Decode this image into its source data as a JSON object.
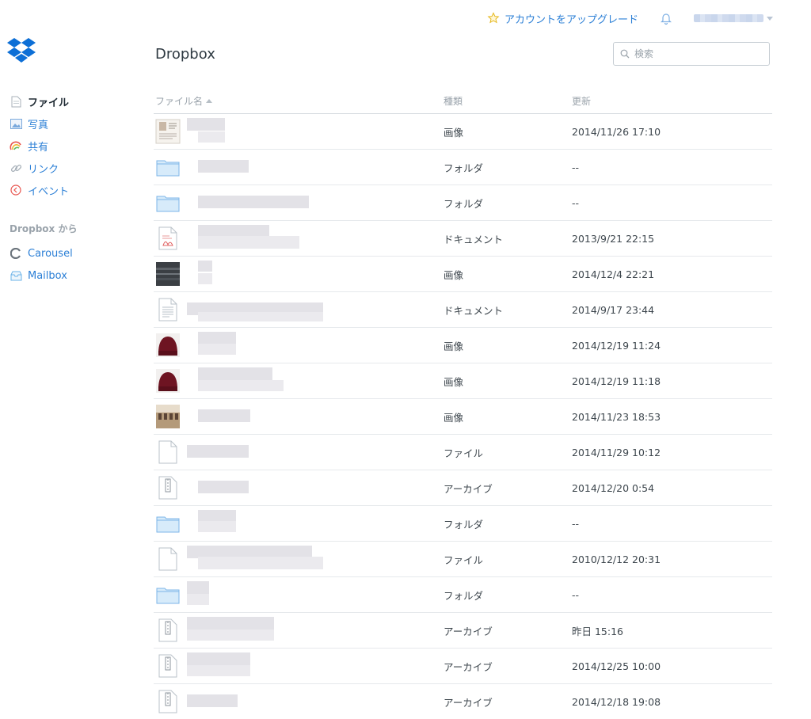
{
  "topbar": {
    "upgrade_label": "アカウントをアップグレード"
  },
  "sidebar": {
    "items": [
      {
        "label": "ファイル",
        "icon": "file-icon",
        "active": true
      },
      {
        "label": "写真",
        "icon": "photo-icon",
        "active": false
      },
      {
        "label": "共有",
        "icon": "rainbow-icon",
        "active": false
      },
      {
        "label": "リンク",
        "icon": "link-icon",
        "active": false
      },
      {
        "label": "イベント",
        "icon": "event-icon",
        "active": false
      }
    ],
    "section_title": "Dropbox から",
    "apps": [
      {
        "label": "Carousel",
        "icon": "carousel-icon"
      },
      {
        "label": "Mailbox",
        "icon": "mailbox-icon"
      }
    ]
  },
  "header": {
    "title": "Dropbox",
    "search_placeholder": "検索"
  },
  "table": {
    "columns": {
      "name": "ファイル名",
      "kind": "種類",
      "modified": "更新"
    },
    "rows": [
      {
        "kind": "画像",
        "modified": "2014/11/26 17:10",
        "thumb": "doc-image"
      },
      {
        "kind": "フォルダ",
        "modified": "--",
        "thumb": "folder"
      },
      {
        "kind": "フォルダ",
        "modified": "--",
        "thumb": "folder"
      },
      {
        "kind": "ドキュメント",
        "modified": "2013/9/21 22:15",
        "thumb": "pdf"
      },
      {
        "kind": "画像",
        "modified": "2014/12/4 22:21",
        "thumb": "dark-image"
      },
      {
        "kind": "ドキュメント",
        "modified": "2014/9/17 23:44",
        "thumb": "document"
      },
      {
        "kind": "画像",
        "modified": "2014/12/19 11:24",
        "thumb": "hat-image"
      },
      {
        "kind": "画像",
        "modified": "2014/12/19 11:18",
        "thumb": "hat-image"
      },
      {
        "kind": "画像",
        "modified": "2014/11/23 18:53",
        "thumb": "room-image"
      },
      {
        "kind": "ファイル",
        "modified": "2014/11/29 10:12",
        "thumb": "file"
      },
      {
        "kind": "アーカイブ",
        "modified": "2014/12/20 0:54",
        "thumb": "archive"
      },
      {
        "kind": "フォルダ",
        "modified": "--",
        "thumb": "folder"
      },
      {
        "kind": "ファイル",
        "modified": "2010/12/12 20:31",
        "thumb": "file"
      },
      {
        "kind": "フォルダ",
        "modified": "--",
        "thumb": "folder"
      },
      {
        "kind": "アーカイブ",
        "modified": "昨日 15:16",
        "thumb": "archive"
      },
      {
        "kind": "アーカイブ",
        "modified": "2014/12/25 10:00",
        "thumb": "archive"
      },
      {
        "kind": "アーカイブ",
        "modified": "2014/12/18 19:08",
        "thumb": "archive"
      }
    ]
  },
  "colors": {
    "link": "#2b7fd6",
    "brand": "#0d6fd6",
    "muted": "#9aa3ab"
  }
}
